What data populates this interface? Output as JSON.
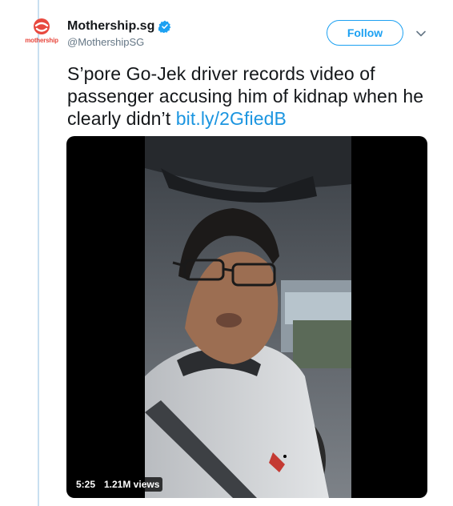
{
  "account": {
    "display_name": "Mothership.sg",
    "handle": "@MothershipSG",
    "logo_text": "mothership",
    "verified": true
  },
  "actions": {
    "follow_label": "Follow"
  },
  "tweet": {
    "text": "S’pore Go-Jek driver records video of passenger accusing him of kidnap when he clearly didn’t ",
    "link_text": "bit.ly/2GfiedB"
  },
  "video": {
    "duration": "5:25",
    "views": "1.21M views"
  },
  "colors": {
    "accent": "#1da1f2",
    "link": "#1b95e0",
    "brand_red": "#e8493f",
    "thread_line": "#c8dff0"
  },
  "icons": {
    "verified": "verified-badge-icon",
    "caret": "chevron-down-icon",
    "logo": "mothership-logo-icon"
  }
}
